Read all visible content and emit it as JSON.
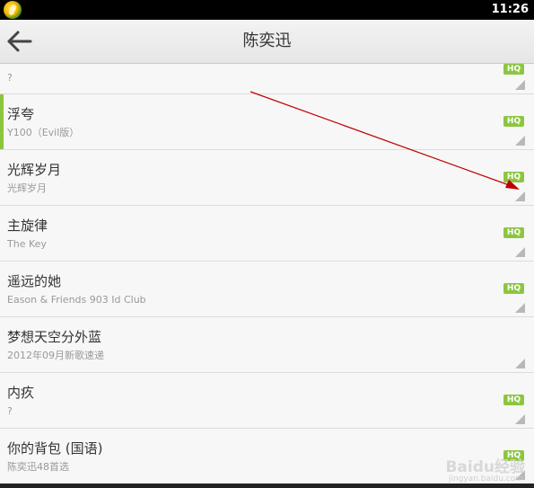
{
  "status_bar": {
    "time": "11:26"
  },
  "header": {
    "title": "陈奕迅"
  },
  "list": {
    "hq_label": "HQ",
    "rows": [
      {
        "title": "",
        "subtitle": "?",
        "hq": true
      },
      {
        "title": "浮夸",
        "subtitle": "Y100（Evil版）",
        "hq": true
      },
      {
        "title": "光辉岁月",
        "subtitle": "光辉岁月",
        "hq": true
      },
      {
        "title": "主旋律",
        "subtitle": "The Key",
        "hq": true
      },
      {
        "title": "遥远的她",
        "subtitle": "Eason & Friends 903 Id Club",
        "hq": true
      },
      {
        "title": "梦想天空分外蓝",
        "subtitle": "2012年09月新歌速递",
        "hq": false
      },
      {
        "title": "内疚",
        "subtitle": "?",
        "hq": true
      },
      {
        "title": "你的背包 (国语)",
        "subtitle": "陈奕迅48首选",
        "hq": true
      }
    ]
  },
  "watermark": {
    "text": "Baidu经验",
    "url": "jingyan.baidu.com"
  },
  "colors": {
    "accent_green": "#8cc63f",
    "arrow_red": "#c00000"
  }
}
